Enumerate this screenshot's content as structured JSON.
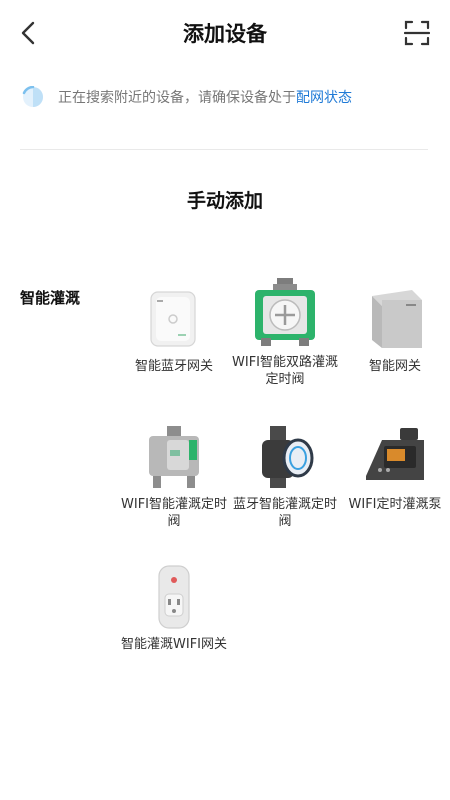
{
  "header": {
    "title": "添加设备",
    "back_icon": "chevron-left-icon",
    "scan_icon": "scan-icon"
  },
  "search": {
    "text": "正在搜索附近的设备，请确保设备处于",
    "link": "配网状态"
  },
  "manual": {
    "title": "手动添加"
  },
  "category": {
    "name": "智能灌溉"
  },
  "devices": [
    {
      "label": "智能蓝牙网关",
      "icon": "bluetooth-gateway-icon"
    },
    {
      "label": "WIFI智能双路灌溉定时阀",
      "icon": "dual-valve-timer-icon"
    },
    {
      "label": "智能网关",
      "icon": "gateway-icon"
    },
    {
      "label": "WIFI智能灌溉定时阀",
      "icon": "wifi-valve-timer-icon"
    },
    {
      "label": "蓝牙智能灌溉定时阀",
      "icon": "bluetooth-valve-timer-icon"
    },
    {
      "label": "WIFI定时灌溉泵",
      "icon": "irrigation-pump-icon"
    },
    {
      "label": "智能灌溉WIFI网关",
      "icon": "wifi-gateway-plug-icon"
    }
  ],
  "colors": {
    "link": "#1f7ad6",
    "valve_green": "#2db36b"
  }
}
